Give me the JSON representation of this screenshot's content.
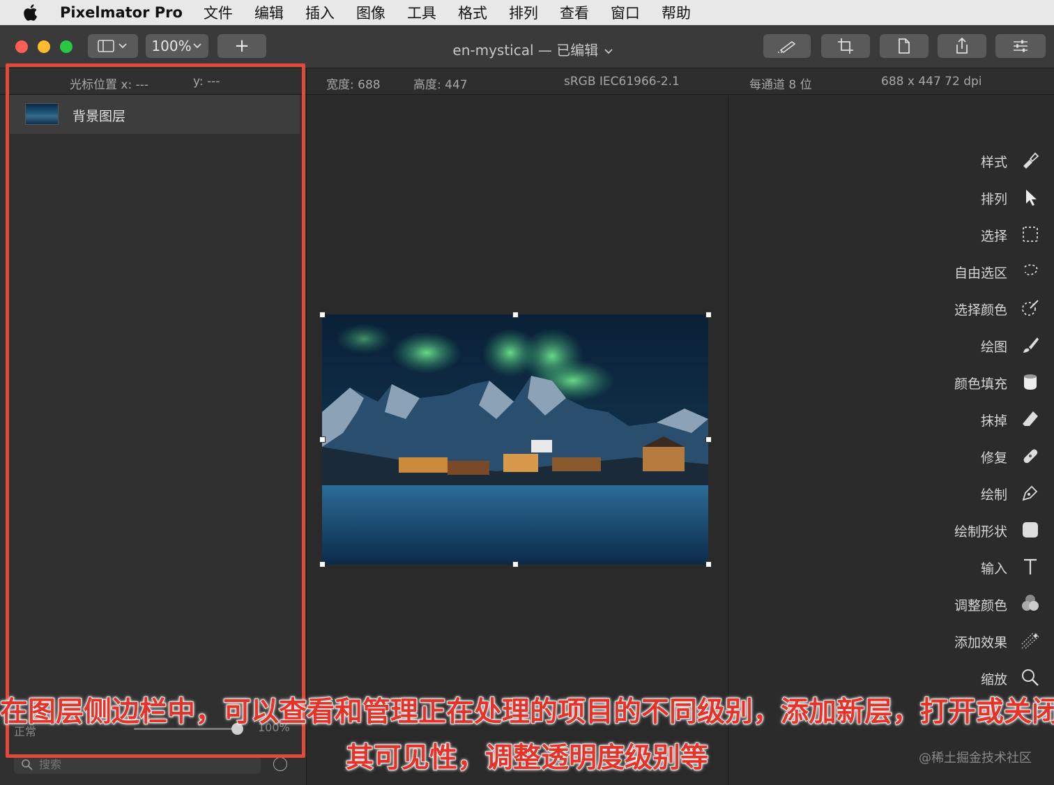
{
  "menubar": {
    "app_name": "Pixelmator Pro",
    "items": [
      "文件",
      "编辑",
      "插入",
      "图像",
      "工具",
      "格式",
      "排列",
      "查看",
      "窗口",
      "帮助"
    ]
  },
  "toolbar": {
    "zoom_label": "100%",
    "add_label": "+",
    "document_title": "en-mystical — 已编辑"
  },
  "info": {
    "cursor_x_label": "光标位置 x: ---",
    "cursor_y_label": "y: ---",
    "width": "宽度: 688",
    "height": "高度: 447",
    "color_profile": "sRGB IEC61966-2.1",
    "bit_depth": "每通道 8 位",
    "size_dpi": "688 x 447 72 dpi"
  },
  "layers": [
    {
      "name": "背景图层"
    }
  ],
  "sidebar_footer": {
    "blend_mode": "正常",
    "opacity": "100%",
    "search_placeholder": "搜索"
  },
  "tools": [
    {
      "label": "样式",
      "icon": "style-brush-icon"
    },
    {
      "label": "排列",
      "icon": "arrow-cursor-icon"
    },
    {
      "label": "选择",
      "icon": "marquee-select-icon"
    },
    {
      "label": "自由选区",
      "icon": "lasso-icon"
    },
    {
      "label": "选择颜色",
      "icon": "color-select-wand-icon"
    },
    {
      "label": "绘图",
      "icon": "paint-brush-icon"
    },
    {
      "label": "颜色填充",
      "icon": "paint-bucket-icon"
    },
    {
      "label": "抹掉",
      "icon": "eraser-icon"
    },
    {
      "label": "修复",
      "icon": "bandage-icon"
    },
    {
      "label": "绘制",
      "icon": "pen-icon"
    },
    {
      "label": "绘制形状",
      "icon": "shape-icon"
    },
    {
      "label": "输入",
      "icon": "text-icon"
    },
    {
      "label": "调整颜色",
      "icon": "color-adjust-icon"
    },
    {
      "label": "添加效果",
      "icon": "effects-icon"
    },
    {
      "label": "缩放",
      "icon": "zoom-icon"
    }
  ],
  "caption": {
    "line1": "在图层侧边栏中，可以查看和管理正在处理的项目的不同级别，添加新层，打开或关闭",
    "line2": "其可见性，调整透明度级别等"
  },
  "watermark": "@稀土掘金技术社区",
  "colors": {
    "highlight_box": "#e14a3b",
    "caption_text": "#e5332a",
    "traffic_close": "#fe5f57",
    "traffic_min": "#febc2e",
    "traffic_max": "#28c840"
  }
}
